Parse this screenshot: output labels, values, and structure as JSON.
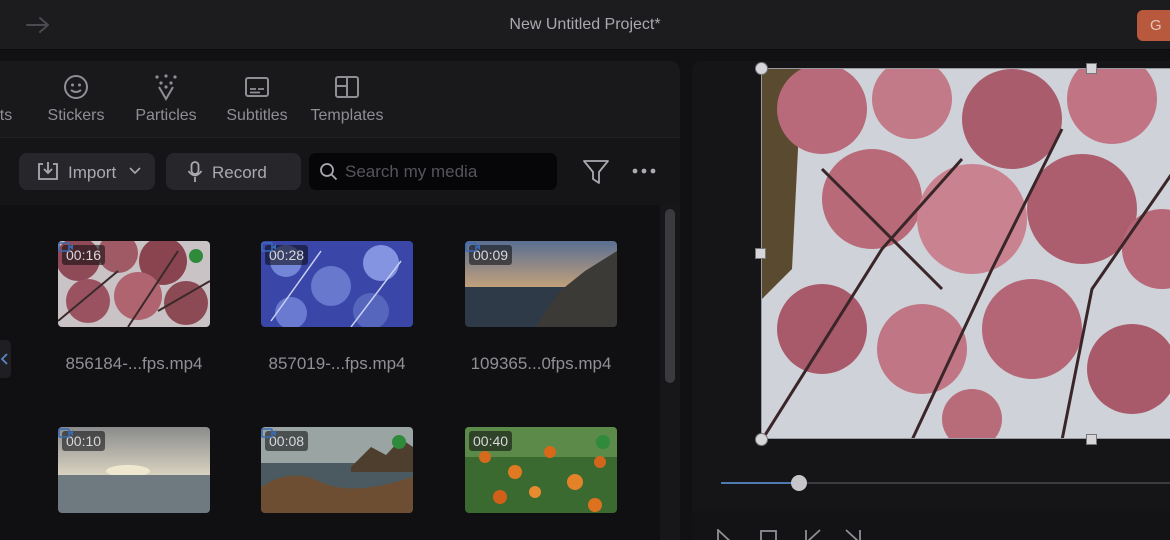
{
  "window": {
    "title": "New Untitled Project*",
    "export_label": "G"
  },
  "tabs": [
    {
      "label": "ts",
      "icon": "effects-icon"
    },
    {
      "label": "Stickers",
      "icon": "sticker-icon"
    },
    {
      "label": "Particles",
      "icon": "particles-icon"
    },
    {
      "label": "Subtitles",
      "icon": "subtitles-icon"
    },
    {
      "label": "Templates",
      "icon": "templates-icon"
    }
  ],
  "toolbar": {
    "import_label": "Import",
    "record_label": "Record",
    "search_placeholder": "Search my media"
  },
  "media": [
    {
      "duration": "00:16",
      "filename": "856184-...fps.mp4",
      "added": true
    },
    {
      "duration": "00:28",
      "filename": "857019-...fps.mp4",
      "added": false
    },
    {
      "duration": "00:09",
      "filename": "109365...0fps.mp4",
      "added": false
    },
    {
      "duration": "00:10",
      "filename": "",
      "added": false
    },
    {
      "duration": "00:08",
      "filename": "",
      "added": true
    },
    {
      "duration": "00:40",
      "filename": "",
      "added": true
    }
  ],
  "player": {
    "progress": 0.17
  },
  "colors": {
    "accent": "#b8593e",
    "scrub": "#4f7ab0",
    "check": "#2f8a3c"
  }
}
